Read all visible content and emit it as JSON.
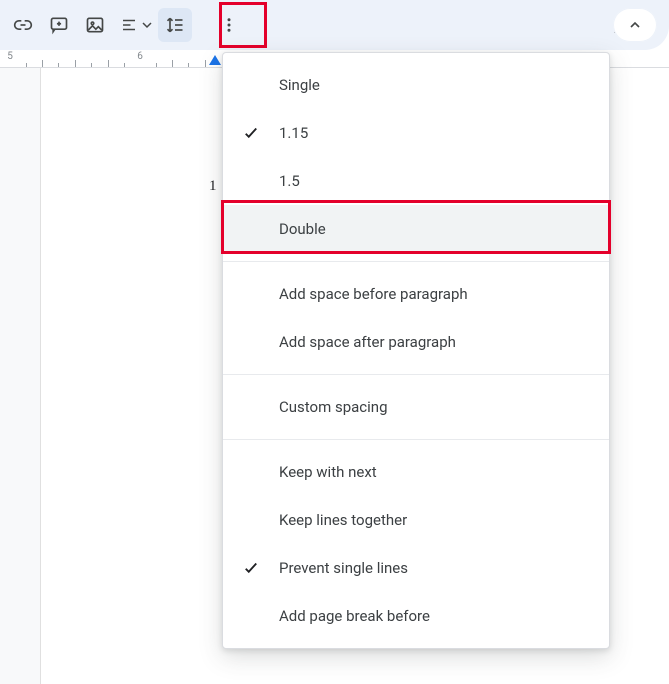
{
  "toolbar": {
    "link_icon": "link-icon",
    "comment_icon": "add-comment-icon",
    "image_icon": "insert-image-icon",
    "align_icon": "align-icon",
    "line_spacing_icon": "line-spacing-icon",
    "more_icon": "more-vert-icon",
    "edit_mode_icon": "edit-pencil-icon",
    "collapse_icon": "chevron-up-icon"
  },
  "ruler": {
    "label_5": "5",
    "label_6": "6"
  },
  "page": {
    "text_1": "1"
  },
  "menu": {
    "group1": [
      {
        "label": "Single",
        "checked": false
      },
      {
        "label": "1.15",
        "checked": true
      },
      {
        "label": "1.5",
        "checked": false
      },
      {
        "label": "Double",
        "checked": false,
        "hovered": true
      }
    ],
    "group2": [
      {
        "label": "Add space before paragraph"
      },
      {
        "label": "Add space after paragraph"
      }
    ],
    "group3": [
      {
        "label": "Custom spacing"
      }
    ],
    "group4": [
      {
        "label": "Keep with next",
        "checked": false
      },
      {
        "label": "Keep lines together",
        "checked": false
      },
      {
        "label": "Prevent single lines",
        "checked": true
      },
      {
        "label": "Add page break before",
        "checked": false
      }
    ]
  }
}
